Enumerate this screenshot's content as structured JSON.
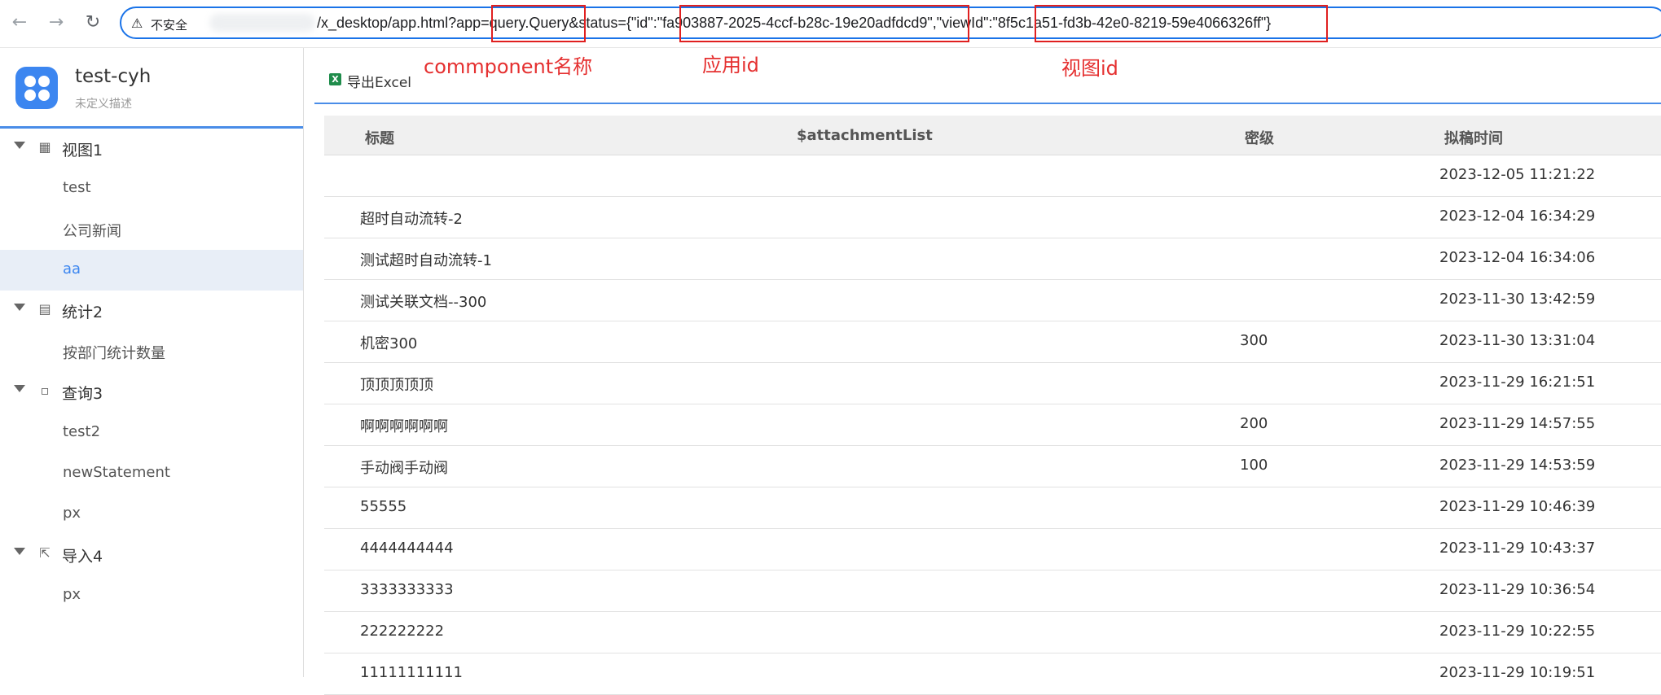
{
  "browser": {
    "insecure_label": "不安全",
    "url": "/x_desktop/app.html?app=query.Query&status={\"id\":\"fa903887-2025-4ccf-b28c-19e20adfdcd9\",\"viewId\":\"8f5c1a51-fd3b-42e0-8219-59e4066326ff\"}"
  },
  "annotations": {
    "component": "commponent名称",
    "app_id": "应用id",
    "view_id": "视图id"
  },
  "app": {
    "name": "test-cyh",
    "description": "未定义描述"
  },
  "sidebar": {
    "groups": [
      {
        "label": "视图1",
        "icon": "table-icon",
        "items": [
          "test",
          "公司新闻",
          "aa"
        ]
      },
      {
        "label": "统计2",
        "icon": "bar-chart-icon",
        "items": [
          "按部门统计数量"
        ]
      },
      {
        "label": "查询3",
        "icon": "query-icon",
        "items": [
          "test2",
          "newStatement",
          "px"
        ]
      },
      {
        "label": "导入4",
        "icon": "import-icon",
        "items": [
          "px"
        ]
      }
    ],
    "active_item": "aa"
  },
  "toolbar": {
    "export_label": "导出Excel"
  },
  "table": {
    "columns": [
      "标题",
      "$attachmentList",
      "密级",
      "拟稿时间"
    ],
    "rows": [
      [
        "",
        "",
        "",
        "2023-12-05 11:21:22"
      ],
      [
        "超时自动流转-2",
        "",
        "",
        "2023-12-04 16:34:29"
      ],
      [
        "测试超时自动流转-1",
        "",
        "",
        "2023-12-04 16:34:06"
      ],
      [
        "测试关联文档--300",
        "",
        "",
        "2023-11-30 13:42:59"
      ],
      [
        "机密300",
        "",
        "300",
        "2023-11-30 13:31:04"
      ],
      [
        "顶顶顶顶顶",
        "",
        "",
        "2023-11-29 16:21:51"
      ],
      [
        "啊啊啊啊啊啊",
        "",
        "200",
        "2023-11-29 14:57:55"
      ],
      [
        "手动阀手动阀",
        "",
        "100",
        "2023-11-29 14:53:59"
      ],
      [
        "55555",
        "",
        "",
        "2023-11-29 10:46:39"
      ],
      [
        "4444444444",
        "",
        "",
        "2023-11-29 10:43:37"
      ],
      [
        "3333333333",
        "",
        "",
        "2023-11-29 10:36:54"
      ],
      [
        "222222222",
        "",
        "",
        "2023-11-29 10:22:55"
      ],
      [
        "11111111111",
        "",
        "",
        "2023-11-29 10:19:51"
      ]
    ]
  }
}
